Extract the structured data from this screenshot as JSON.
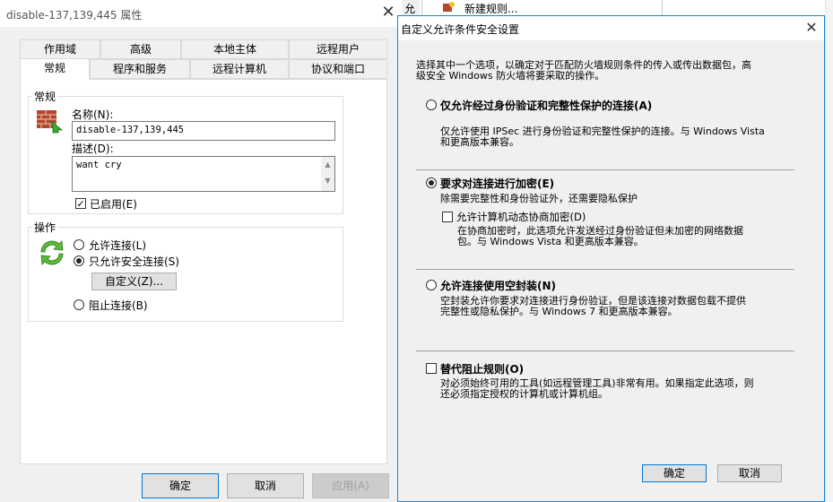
{
  "back_dialog": {
    "title": "disable-137,139,445 属性",
    "close_glyph": "✕",
    "tabs_row1": [
      "作用域",
      "高级",
      "本地主体",
      "远程用户"
    ],
    "tabs_row2": [
      "常规",
      "程序和服务",
      "远程计算机",
      "协议和端口"
    ],
    "general_group_label": "常规",
    "name_label": "名称(N):",
    "name_value": "disable-137,139,445",
    "desc_label": "描述(D):",
    "desc_value": "want cry",
    "enabled_label": "已启用(E)",
    "enabled_checked": true,
    "action_group_label": "操作",
    "allow_label": "允许连接(L)",
    "secure_only_label": "只允许安全连接(S)",
    "customize_button": "自定义(Z)...",
    "block_label": "阻止连接(B)",
    "ok_button": "确定",
    "cancel_button": "取消",
    "apply_button": "应用(A)"
  },
  "background_window": {
    "title_fragment": "允",
    "new_rule_label": "新建规则..."
  },
  "front_dialog": {
    "title": "自定义允许条件安全设置",
    "close_glyph": "✕",
    "intro_line1": "选择其中一个选项，以确定对于匹配防火墙规则条件的传入或传出数据包，高",
    "intro_line2": "级安全 Windows 防火墙将要采取的操作。",
    "opt1_label": "仅允许经过身份验证和完整性保护的连接(A)",
    "opt1_desc1": "仅允许使用 IPSec 进行身份验证和完整性保护的连接。与 Windows Vista",
    "opt1_desc2": "和更高版本兼容。",
    "opt2_label": "要求对连接进行加密(E)",
    "opt2_desc": "除需要完整性和身份验证外，还需要隐私保护",
    "opt2_sub_label": "允许计算机动态协商加密(D)",
    "opt2_sub_desc1": "在协商加密时，此选项允许发送经过身份验证但未加密的网络数据",
    "opt2_sub_desc2": "包。与 Windows Vista 和更高版本兼容。",
    "opt3_label": "允许连接使用空封装(N)",
    "opt3_desc1": "空封装允许你要求对连接进行身份验证，但是该连接对数据包载不提供",
    "opt3_desc2": "完整性或隐私保护。与 Windows 7 和更高版本兼容。",
    "override_label": "替代阻止规则(O)",
    "override_desc1": "对必须始终可用的工具(如远程管理工具)非常有用。如果指定此选项，则",
    "override_desc2": "还必须指定授权的计算机或计算机组。",
    "ok_button": "确定",
    "cancel_button": "取消",
    "selected_option": "opt2"
  }
}
